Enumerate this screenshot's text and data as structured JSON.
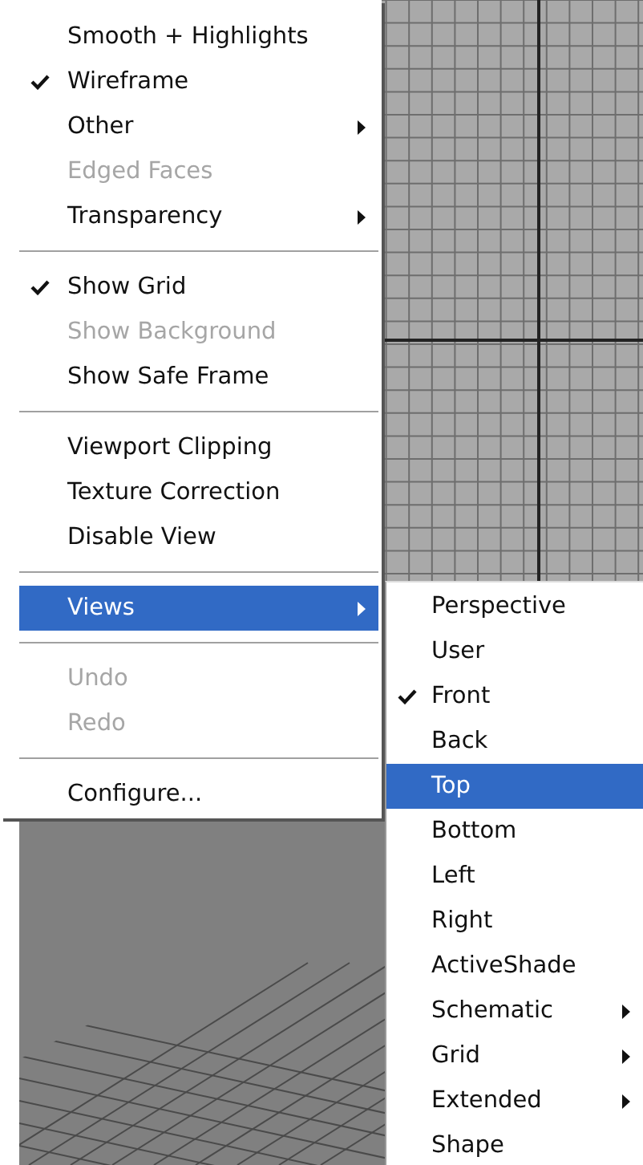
{
  "main_menu": {
    "items": [
      {
        "kind": "item",
        "label": "Smooth + Highlights",
        "checked": false,
        "disabled": false,
        "submenu": false,
        "selected": false
      },
      {
        "kind": "item",
        "label": "Wireframe",
        "checked": true,
        "disabled": false,
        "submenu": false,
        "selected": false
      },
      {
        "kind": "item",
        "label": "Other",
        "checked": false,
        "disabled": false,
        "submenu": true,
        "selected": false
      },
      {
        "kind": "item",
        "label": "Edged Faces",
        "checked": false,
        "disabled": true,
        "submenu": false,
        "selected": false
      },
      {
        "kind": "item",
        "label": "Transparency",
        "checked": false,
        "disabled": false,
        "submenu": true,
        "selected": false
      },
      {
        "kind": "separator"
      },
      {
        "kind": "item",
        "label": "Show Grid",
        "checked": true,
        "disabled": false,
        "submenu": false,
        "selected": false
      },
      {
        "kind": "item",
        "label": "Show Background",
        "checked": false,
        "disabled": true,
        "submenu": false,
        "selected": false
      },
      {
        "kind": "item",
        "label": "Show Safe Frame",
        "checked": false,
        "disabled": false,
        "submenu": false,
        "selected": false
      },
      {
        "kind": "separator"
      },
      {
        "kind": "item",
        "label": "Viewport Clipping",
        "checked": false,
        "disabled": false,
        "submenu": false,
        "selected": false
      },
      {
        "kind": "item",
        "label": "Texture Correction",
        "checked": false,
        "disabled": false,
        "submenu": false,
        "selected": false
      },
      {
        "kind": "item",
        "label": "Disable View",
        "checked": false,
        "disabled": false,
        "submenu": false,
        "selected": false
      },
      {
        "kind": "separator"
      },
      {
        "kind": "item",
        "label": "Views",
        "checked": false,
        "disabled": false,
        "submenu": true,
        "selected": true
      },
      {
        "kind": "separator"
      },
      {
        "kind": "item",
        "label": "Undo",
        "checked": false,
        "disabled": true,
        "submenu": false,
        "selected": false
      },
      {
        "kind": "item",
        "label": "Redo",
        "checked": false,
        "disabled": true,
        "submenu": false,
        "selected": false
      },
      {
        "kind": "separator"
      },
      {
        "kind": "item",
        "label": "Configure...",
        "checked": false,
        "disabled": false,
        "submenu": false,
        "selected": false
      }
    ]
  },
  "views_submenu": {
    "items": [
      {
        "kind": "item",
        "label": "Perspective",
        "checked": false,
        "disabled": false,
        "submenu": false,
        "selected": false
      },
      {
        "kind": "item",
        "label": "User",
        "checked": false,
        "disabled": false,
        "submenu": false,
        "selected": false
      },
      {
        "kind": "item",
        "label": "Front",
        "checked": true,
        "disabled": false,
        "submenu": false,
        "selected": false
      },
      {
        "kind": "item",
        "label": "Back",
        "checked": false,
        "disabled": false,
        "submenu": false,
        "selected": false
      },
      {
        "kind": "item",
        "label": "Top",
        "checked": false,
        "disabled": false,
        "submenu": false,
        "selected": true
      },
      {
        "kind": "item",
        "label": "Bottom",
        "checked": false,
        "disabled": false,
        "submenu": false,
        "selected": false
      },
      {
        "kind": "item",
        "label": "Left",
        "checked": false,
        "disabled": false,
        "submenu": false,
        "selected": false
      },
      {
        "kind": "item",
        "label": "Right",
        "checked": false,
        "disabled": false,
        "submenu": false,
        "selected": false
      },
      {
        "kind": "item",
        "label": "ActiveShade",
        "checked": false,
        "disabled": false,
        "submenu": false,
        "selected": false
      },
      {
        "kind": "item",
        "label": "Schematic",
        "checked": false,
        "disabled": false,
        "submenu": true,
        "selected": false
      },
      {
        "kind": "item",
        "label": "Grid",
        "checked": false,
        "disabled": false,
        "submenu": true,
        "selected": false
      },
      {
        "kind": "item",
        "label": "Extended",
        "checked": false,
        "disabled": false,
        "submenu": true,
        "selected": false
      },
      {
        "kind": "item",
        "label": "Shape",
        "checked": false,
        "disabled": false,
        "submenu": false,
        "selected": false
      }
    ]
  }
}
